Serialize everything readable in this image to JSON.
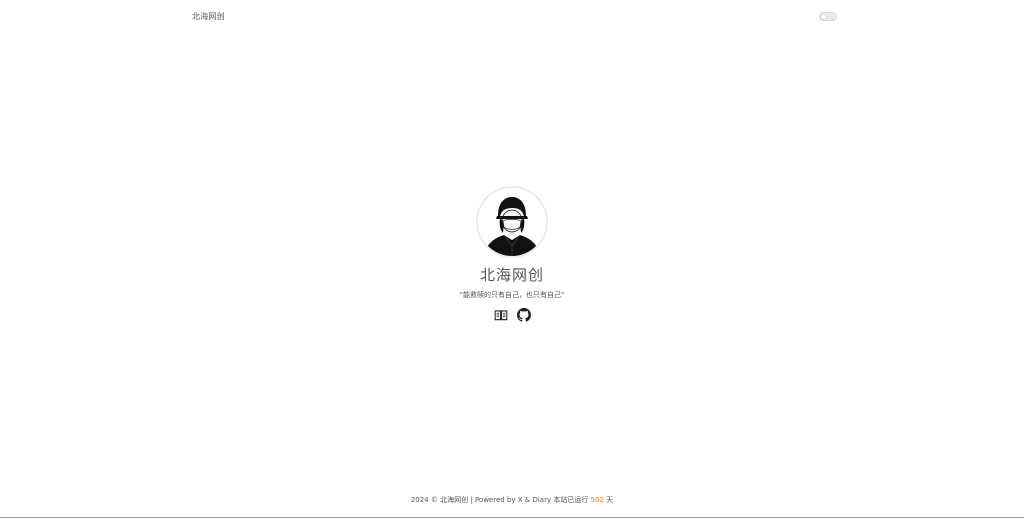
{
  "header": {
    "brand": "北海网创",
    "theme_toggle": "toggle-switch"
  },
  "profile": {
    "avatar": "avatar-person-with-hood",
    "name": "北海网创",
    "motto": "\"能救赎的只有自己，也只有自己\"",
    "links": [
      {
        "icon": "book-icon"
      },
      {
        "icon": "github-icon"
      }
    ]
  },
  "footer": {
    "year": "2024",
    "copyright_symbol": "©",
    "owner": "北海网创",
    "separator": "|",
    "powered_by": "Powered by X & Diary",
    "run_prefix": "本站已运行",
    "run_days": "502",
    "run_suffix": "天"
  }
}
